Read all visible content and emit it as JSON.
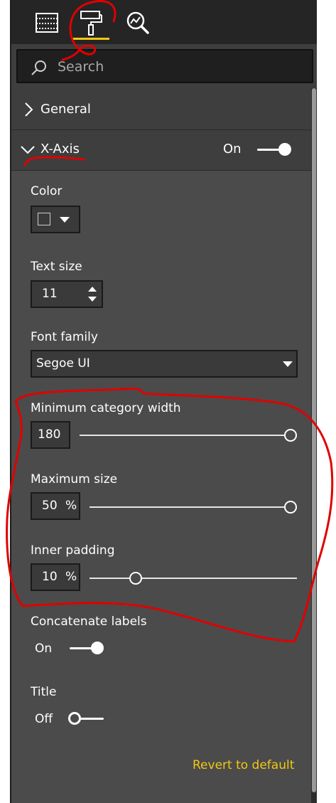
{
  "toolbar": {
    "tabs": [
      {
        "icon": "fields-grid-icon"
      },
      {
        "icon": "paint-roller-icon",
        "active": true
      },
      {
        "icon": "analytics-magnifier-icon"
      }
    ]
  },
  "search": {
    "placeholder": "Search"
  },
  "sections": {
    "general": {
      "label": "General"
    },
    "xaxis": {
      "label": "X-Axis",
      "toggle_label": "On",
      "on": true
    }
  },
  "fields": {
    "color": {
      "label": "Color",
      "value": "#3a3a3a"
    },
    "text_size": {
      "label": "Text size",
      "value": "11"
    },
    "font_family": {
      "label": "Font family",
      "value": "Segoe UI"
    },
    "min_category_width": {
      "label": "Minimum category width",
      "value": "180",
      "level": 1.0
    },
    "max_size": {
      "label": "Maximum size",
      "value": "50",
      "unit": "%",
      "level": 1.0
    },
    "inner_padding": {
      "label": "Inner padding",
      "value": "10",
      "unit": "%",
      "level": 0.22
    },
    "concatenate_labels": {
      "label": "Concatenate labels",
      "toggle_label": "On",
      "on": true
    },
    "title": {
      "label": "Title",
      "toggle_label": "Off",
      "on": false
    }
  },
  "footer": {
    "revert_label": "Revert to default"
  },
  "colors": {
    "accent": "#f2c811",
    "panel": "#3e3e3e",
    "section": "#4b4b4b",
    "annotation": "#e00000"
  }
}
